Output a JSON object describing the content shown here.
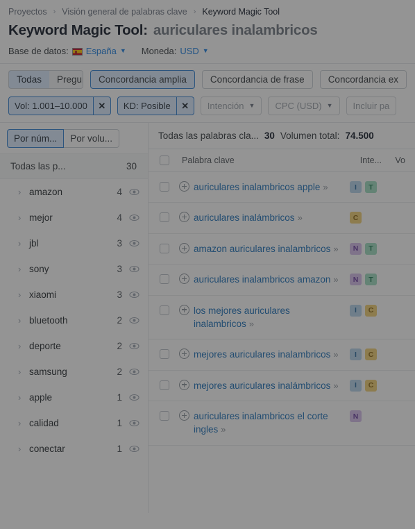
{
  "breadcrumb": {
    "items": [
      {
        "label": "Proyectos",
        "active": false
      },
      {
        "label": "Visión general de palabras clave",
        "active": false
      },
      {
        "label": "Keyword Magic Tool",
        "active": true
      }
    ],
    "separator": "›"
  },
  "header": {
    "title": "Keyword Magic Tool:",
    "keyword": "auriculares inalambricos",
    "database_label": "Base de datos:",
    "database_value": "España",
    "database_flag": "spain-flag-icon",
    "currency_label": "Moneda:",
    "currency_value": "USD",
    "caret_icon": "chevron-down-icon"
  },
  "tabs": {
    "segment": [
      {
        "label": "Todas",
        "selected": true
      },
      {
        "label": "Preguntas",
        "selected": false
      }
    ],
    "match_tabs": [
      {
        "label": "Concordancia amplia",
        "selected": true
      },
      {
        "label": "Concordancia de frase",
        "selected": false
      },
      {
        "label": "Concordancia ex",
        "selected": false
      }
    ]
  },
  "filters": {
    "chips": [
      {
        "label": "Vol: 1.001–10.000",
        "remove_icon": "close-icon"
      },
      {
        "label": "KD: Posible",
        "remove_icon": "close-icon"
      }
    ],
    "dropdowns": [
      {
        "label": "Intención"
      },
      {
        "label": "CPC (USD)"
      }
    ],
    "include_placeholder": "Incluir pa"
  },
  "groups_panel": {
    "tabs": [
      {
        "label": "Por núm...",
        "selected": true
      },
      {
        "label": "Por volu...",
        "selected": false
      }
    ],
    "all_row": {
      "label": "Todas las p...",
      "count": "30"
    },
    "eye_icon": "eye-icon",
    "chevron_icon": "chevron-right-icon",
    "items": [
      {
        "label": "amazon",
        "count": "4"
      },
      {
        "label": "mejor",
        "count": "4"
      },
      {
        "label": "jbl",
        "count": "3"
      },
      {
        "label": "sony",
        "count": "3"
      },
      {
        "label": "xiaomi",
        "count": "3"
      },
      {
        "label": "bluetooth",
        "count": "2"
      },
      {
        "label": "deporte",
        "count": "2"
      },
      {
        "label": "samsung",
        "count": "2"
      },
      {
        "label": "apple",
        "count": "1"
      },
      {
        "label": "calidad",
        "count": "1"
      },
      {
        "label": "conectar",
        "count": "1"
      }
    ]
  },
  "table": {
    "summary_label": "Todas las palabras cla...",
    "summary_count": "30",
    "volume_label": "Volumen total:",
    "volume_total": "74.500",
    "columns": {
      "keyword": "Palabra clave",
      "intent": "Inte...",
      "volume": "Vo"
    },
    "serp_icon": "chevron-double-right-icon",
    "add_icon": "plus-circle-icon",
    "checkbox_icon": "checkbox-icon",
    "rows": [
      {
        "keyword": "auriculares inalambricos apple",
        "intents": [
          "I",
          "T"
        ]
      },
      {
        "keyword": "auriculares inalámbricos",
        "intents": [
          "C"
        ]
      },
      {
        "keyword": "amazon auriculares inalambricos",
        "intents": [
          "N",
          "T"
        ]
      },
      {
        "keyword": "auriculares inalambricos amazon",
        "intents": [
          "N",
          "T"
        ]
      },
      {
        "keyword": "los mejores auriculares inalambricos",
        "intents": [
          "I",
          "C"
        ]
      },
      {
        "keyword": "mejores auriculares inalambricos",
        "intents": [
          "I",
          "C"
        ]
      },
      {
        "keyword": "mejores auriculares inalámbricos",
        "intents": [
          "I",
          "C"
        ]
      },
      {
        "keyword": "auriculares inalambricos el corte ingles",
        "intents": [
          "N"
        ]
      }
    ]
  },
  "colors": {
    "link": "#1a6fb8",
    "accent": "#2f7fd1",
    "chip_bg": "#dbeafe",
    "intent_I": "#b5d3ea",
    "intent_T": "#9fdcc0",
    "intent_C": "#f0cf72",
    "intent_N": "#d5bdea"
  }
}
